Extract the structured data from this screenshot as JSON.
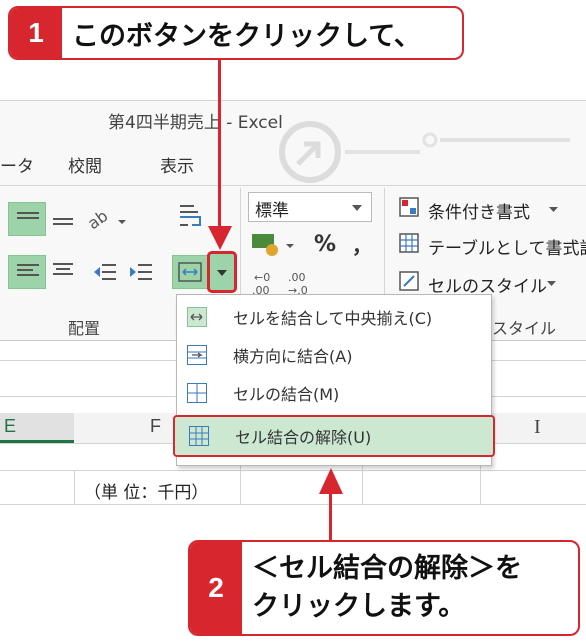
{
  "callout1": {
    "number": "1",
    "text": "このボタンをクリックして、"
  },
  "callout2": {
    "number": "2",
    "line1": "＜セル結合の解除＞を",
    "line2": "クリックします。"
  },
  "window": {
    "title": "第4四半期売上 - Excel"
  },
  "tabs": [
    "ータ",
    "校閲",
    "表示"
  ],
  "ribbon": {
    "alignment_group_label": "配置",
    "number_format_value": "標準",
    "percent_symbol": "%",
    "comma_symbol": "，",
    "styles": {
      "conditional": "条件付き書式",
      "table": "テーブルとして書式設",
      "cell_styles": "セルのスタイル",
      "group_label": "スタイル"
    }
  },
  "merge_menu": {
    "items": [
      {
        "label": "セルを結合して中央揃え(C)"
      },
      {
        "label": "横方向に結合(A)"
      },
      {
        "label": "セルの結合(M)"
      },
      {
        "label": "セル結合の解除(U)"
      }
    ]
  },
  "sheet": {
    "col_e": "E",
    "col_f": "F",
    "cursor": "I",
    "unit_cell": "（単 位：千円）"
  },
  "colors": {
    "accent_red": "#d8262e",
    "excel_green": "#217346",
    "highlight_green": "#cde8d1"
  }
}
